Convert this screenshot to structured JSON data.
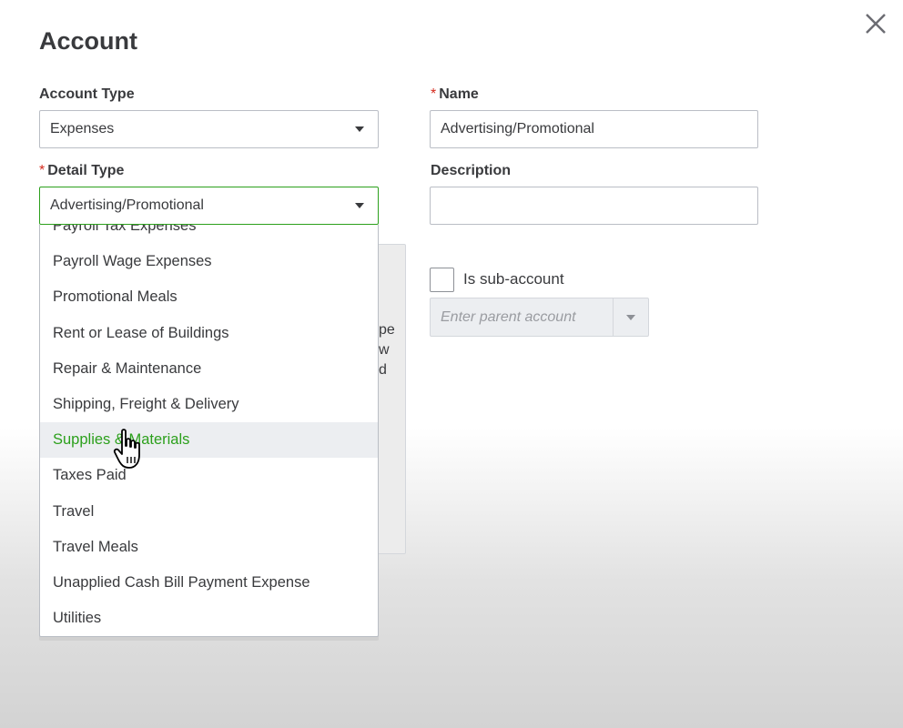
{
  "dialog": {
    "title": "Account",
    "close_icon": "close-icon"
  },
  "account_type": {
    "label": "Account Type",
    "value": "Expenses"
  },
  "name": {
    "required_marker": "*",
    "label": "Name",
    "value": "Advertising/Promotional"
  },
  "detail_type": {
    "required_marker": "*",
    "label": "Detail Type",
    "value": "Advertising/Promotional",
    "options": [
      "Payroll Tax Expenses",
      "Payroll Wage Expenses",
      "Promotional Meals",
      "Rent or Lease of Buildings",
      "Repair & Maintenance",
      "Shipping, Freight & Delivery",
      "Supplies & Materials",
      "Taxes Paid",
      "Travel",
      "Travel Meals",
      "Unapplied Cash Bill Payment Expense",
      "Utilities"
    ],
    "highlighted_index": 6
  },
  "description": {
    "label": "Description",
    "value": ""
  },
  "help_text_fragments": [
    "pe",
    "w",
    "d"
  ],
  "sub_account": {
    "label": "Is sub-account",
    "checked": false,
    "parent_placeholder": "Enter parent account"
  },
  "colors": {
    "accent_green": "#2ca01c",
    "required_red": "#d52b1e",
    "text": "#393a3d",
    "border": "#babec5"
  }
}
